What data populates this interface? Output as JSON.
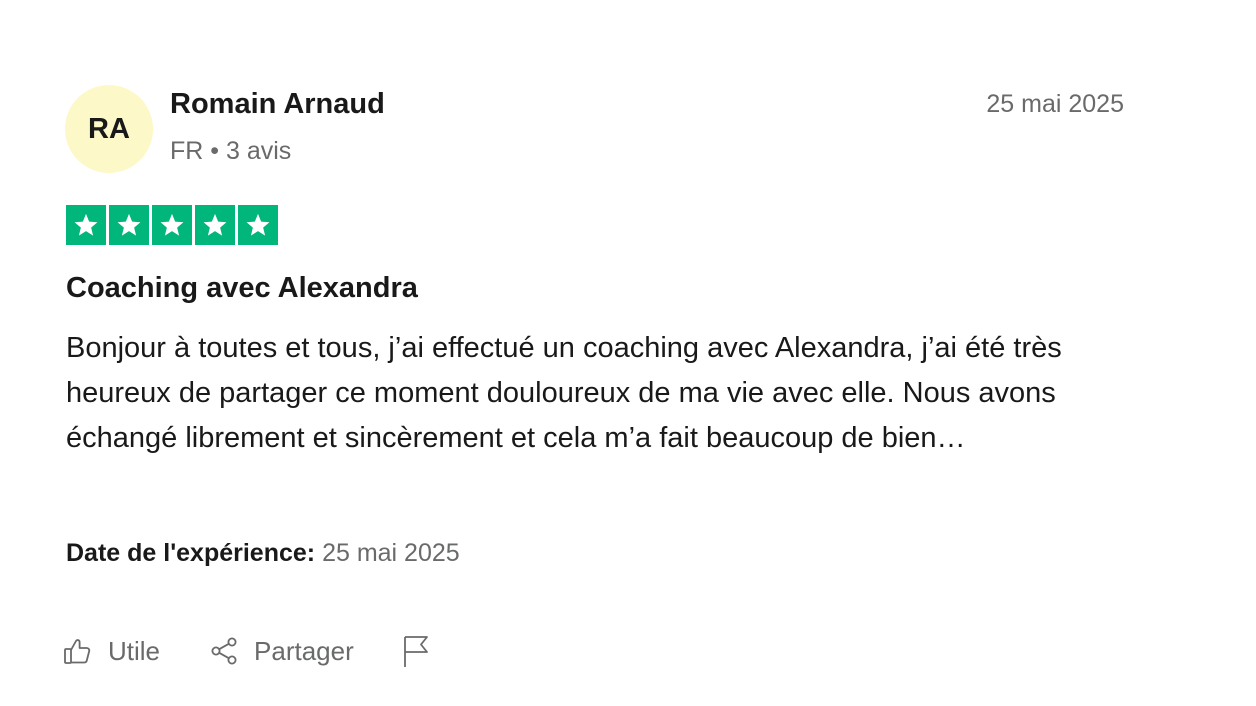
{
  "reviewer": {
    "initials": "RA",
    "name": "Romain Arnaud",
    "meta": "FR • 3 avis"
  },
  "review": {
    "date": "25 mai 2025",
    "rating": 5,
    "rating_color": "#00b67a",
    "title": "Coaching avec Alexandra",
    "body": "Bonjour à toutes et tous, j’ai effectué un coaching avec Alexandra, j’ai été très heureux de partager ce moment douloureux de ma vie avec elle. Nous avons échangé librement et sincèrement et cela m’a fait beaucoup de bien…",
    "experience_label": "Date de l'expérience:",
    "experience_date": "25 mai 2025"
  },
  "actions": {
    "useful_label": "Utile",
    "useful_icon": "thumbs-up-icon",
    "share_label": "Partager",
    "share_icon": "share-icon",
    "flag_icon": "flag-icon"
  },
  "colors": {
    "avatar_bg": "#fdf8c7",
    "muted_text": "#696a6a",
    "primary_text": "#191919"
  }
}
